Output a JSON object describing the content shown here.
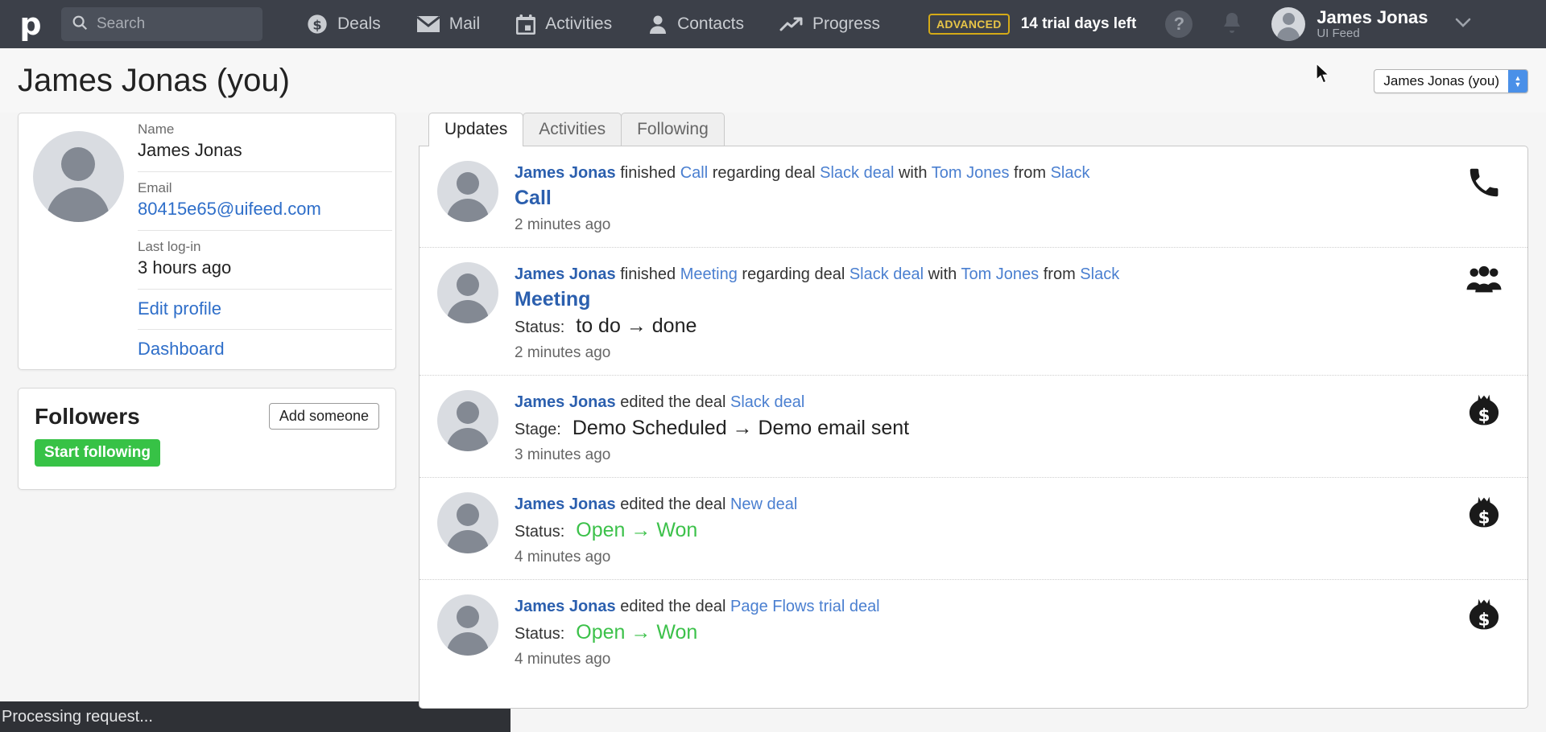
{
  "topnav": {
    "logo": "p",
    "search_placeholder": "Search",
    "items": [
      {
        "label": "Deals",
        "icon": "dollar-circle-icon"
      },
      {
        "label": "Mail",
        "icon": "envelope-icon"
      },
      {
        "label": "Activities",
        "icon": "calendar-icon"
      },
      {
        "label": "Contacts",
        "icon": "person-icon"
      },
      {
        "label": "Progress",
        "icon": "trend-up-icon"
      }
    ],
    "plan_badge": "ADVANCED",
    "trial_text": "14 trial days left",
    "help_label": "?",
    "user": {
      "name": "James Jonas",
      "subtitle": "UI Feed"
    }
  },
  "pagehead": {
    "title": "James Jonas (you)",
    "user_select_value": "James Jonas (you)"
  },
  "profile": {
    "fields": [
      {
        "label": "Name",
        "value": "James Jonas",
        "is_link": false
      },
      {
        "label": "Email",
        "value": "80415e65@uifeed.com",
        "is_link": true
      },
      {
        "label": "Last log-in",
        "value": "3 hours ago",
        "is_link": false
      }
    ],
    "links": [
      {
        "label": "Edit profile"
      },
      {
        "label": "Dashboard"
      }
    ]
  },
  "followers": {
    "title": "Followers",
    "add_button": "Add someone",
    "follow_button": "Start following"
  },
  "feed": {
    "tabs": [
      {
        "label": "Updates",
        "active": true
      },
      {
        "label": "Activities",
        "active": false
      },
      {
        "label": "Following",
        "active": false
      }
    ],
    "items": [
      {
        "actor": "James Jonas",
        "verb": " finished ",
        "object": "Call",
        "mid": " regarding deal ",
        "deal": "Slack deal",
        "with_label": " with ",
        "person": "Tom Jones",
        "from_label": " from ",
        "org": "Slack",
        "subject": "Call",
        "change_label": "",
        "change_from": "",
        "change_arrow": "",
        "change_to": "",
        "change_green": false,
        "time": "2 minutes ago",
        "icon": "phone-icon"
      },
      {
        "actor": "James Jonas",
        "verb": " finished ",
        "object": "Meeting",
        "mid": " regarding deal ",
        "deal": "Slack deal",
        "with_label": " with ",
        "person": "Tom Jones",
        "from_label": " from ",
        "org": "Slack",
        "subject": "Meeting",
        "change_label": "Status:",
        "change_from": "to do",
        "change_arrow": "→",
        "change_to": "done",
        "change_green": false,
        "time": "2 minutes ago",
        "icon": "people-icon"
      },
      {
        "actor": "James Jonas",
        "verb": " edited the deal ",
        "object": "",
        "mid": "",
        "deal": "Slack deal",
        "with_label": "",
        "person": "",
        "from_label": "",
        "org": "",
        "subject": "",
        "change_label": "Stage:",
        "change_from": "Demo Scheduled",
        "change_arrow": "→",
        "change_to": "Demo email sent",
        "change_green": false,
        "time": "3 minutes ago",
        "icon": "money-bag-icon"
      },
      {
        "actor": "James Jonas",
        "verb": " edited the deal ",
        "object": "",
        "mid": "",
        "deal": "New deal",
        "with_label": "",
        "person": "",
        "from_label": "",
        "org": "",
        "subject": "",
        "change_label": "Status:",
        "change_from": "Open",
        "change_arrow": "→",
        "change_to": "Won",
        "change_green": true,
        "time": "4 minutes ago",
        "icon": "money-bag-icon"
      },
      {
        "actor": "James Jonas",
        "verb": " edited the deal ",
        "object": "",
        "mid": "",
        "deal": "Page Flows trial deal",
        "with_label": "",
        "person": "",
        "from_label": "",
        "org": "",
        "subject": "",
        "change_label": "Status:",
        "change_from": "Open",
        "change_arrow": "→",
        "change_to": "Won",
        "change_green": true,
        "time": "4 minutes ago",
        "icon": "money-bag-icon"
      }
    ]
  },
  "toast": {
    "message": "Processing request..."
  },
  "colors": {
    "nav_bg": "#3c4049",
    "link": "#2e6ec9",
    "green": "#37c246",
    "badge": "#e8c547"
  }
}
